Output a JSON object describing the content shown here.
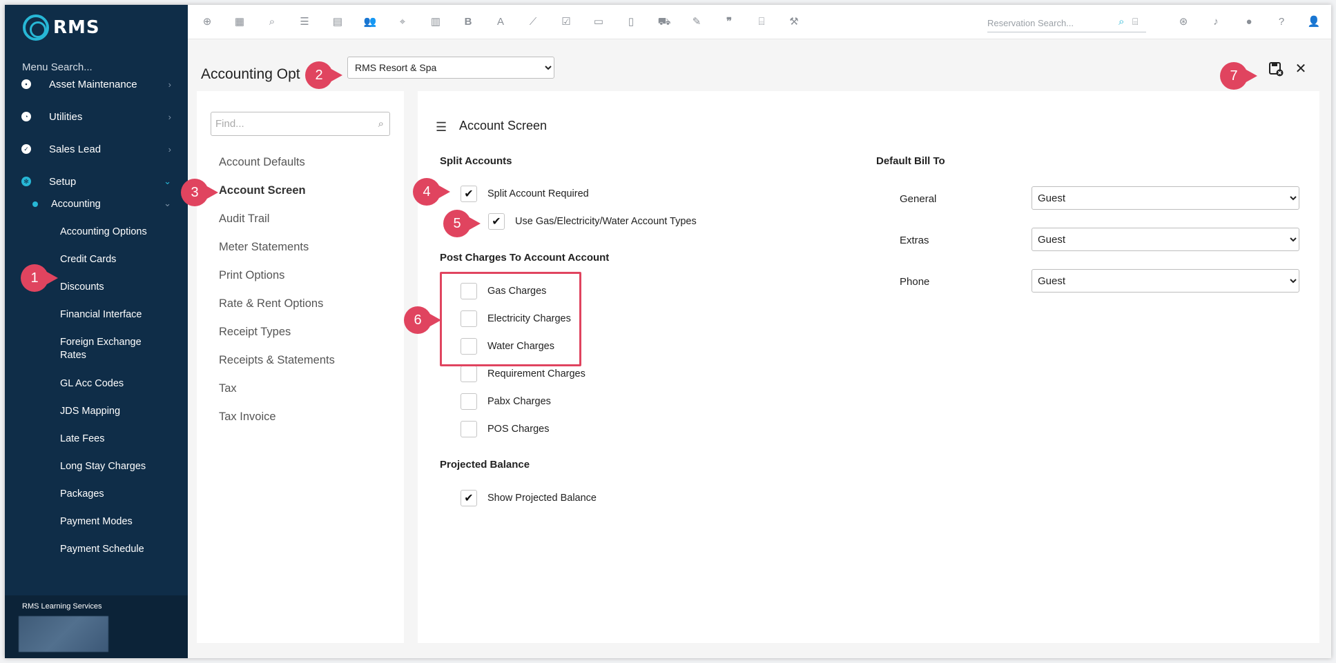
{
  "app": {
    "logo_text": "RMS",
    "accent_color": "#27b7d6",
    "sidebar_color": "#0f2d48",
    "annotation_color": "#e0445f"
  },
  "sidebar": {
    "menu_search": "Menu Search...",
    "items": [
      {
        "label": "Asset Maintenance",
        "icon": "toolbox-icon"
      },
      {
        "label": "Utilities",
        "icon": "gauge-icon"
      },
      {
        "label": "Sales Lead",
        "icon": "check-circle-icon"
      },
      {
        "label": "Setup",
        "icon": "gear-icon"
      }
    ],
    "accounting_label": "Accounting",
    "sub_items": [
      "Accounting Options",
      "Credit Cards",
      "Discounts",
      "Financial Interface",
      "Foreign Exchange Rates",
      "GL Acc Codes",
      "JDS Mapping",
      "Late Fees",
      "Long Stay Charges",
      "Packages",
      "Payment Modes",
      "Payment Schedule"
    ],
    "footer_label": "RMS Learning Services"
  },
  "topbar": {
    "icons": [
      "add-icon",
      "calendar-icon",
      "search-icon",
      "sliders-icon",
      "grid-icon",
      "users-icon",
      "map-pin-icon",
      "map-icon",
      "bold-icon",
      "font-icon",
      "chart-icon",
      "checklist-icon",
      "id-card-icon",
      "report-icon",
      "cart-icon",
      "ticket-icon",
      "quote-icon",
      "bed-icon",
      "gavel-icon"
    ],
    "reservation_search_placeholder": "Reservation Search...",
    "right_icons": [
      "globe-icon",
      "bell-icon",
      "chat-icon",
      "help-icon",
      "user-icon"
    ]
  },
  "page": {
    "title": "Accounting Opt",
    "property": "RMS Resort & Spa"
  },
  "options_list": {
    "find_placeholder": "Find...",
    "items": [
      "Account Defaults",
      "Account Screen",
      "Audit Trail",
      "Meter Statements",
      "Print Options",
      "Rate & Rent Options",
      "Receipt Types",
      "Receipts & Statements",
      "Tax",
      "Tax Invoice"
    ],
    "active_index": 1
  },
  "account_screen": {
    "title": "Account Screen",
    "split_accounts": {
      "heading": "Split Accounts",
      "split_required": {
        "label": "Split Account Required",
        "checked": true
      },
      "use_types": {
        "label": "Use Gas/Electricity/Water Account Types",
        "checked": true
      }
    },
    "post_charges": {
      "heading": "Post Charges To Account Account",
      "items": [
        {
          "label": "Gas Charges",
          "checked": false
        },
        {
          "label": "Electricity Charges",
          "checked": false
        },
        {
          "label": "Water Charges",
          "checked": false
        },
        {
          "label": "Requirement Charges",
          "checked": false
        },
        {
          "label": "Pabx Charges",
          "checked": false
        },
        {
          "label": "POS Charges",
          "checked": false
        }
      ]
    },
    "projected_balance": {
      "heading": "Projected Balance",
      "show": {
        "label": "Show Projected Balance",
        "checked": true
      }
    },
    "default_bill_to": {
      "heading": "Default Bill To",
      "rows": [
        {
          "label": "General",
          "value": "Guest"
        },
        {
          "label": "Extras",
          "value": "Guest"
        },
        {
          "label": "Phone",
          "value": "Guest"
        }
      ]
    }
  },
  "annotations": [
    "1",
    "2",
    "3",
    "4",
    "5",
    "6",
    "7"
  ],
  "check_mark": "✔"
}
